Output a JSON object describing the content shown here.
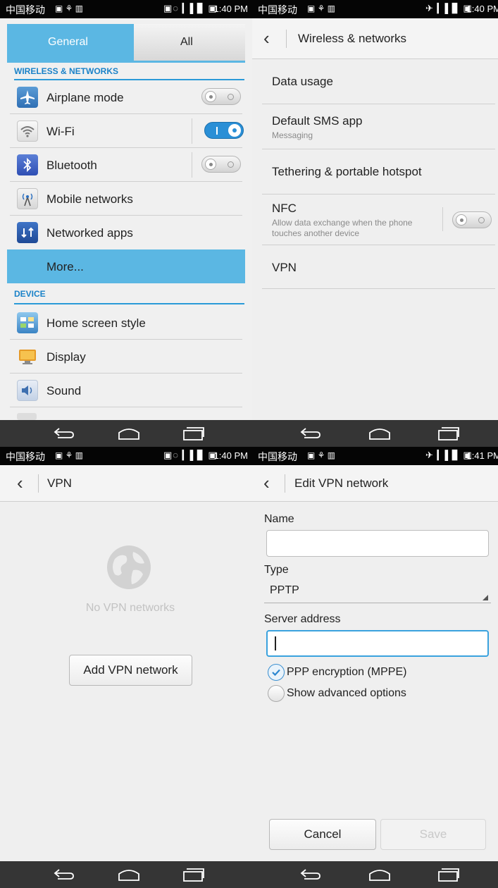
{
  "status": {
    "carrier": "中国移动",
    "times": [
      "1:40 PM",
      "1:40 PM",
      "1:40 PM",
      "1:41 PM"
    ]
  },
  "panel1": {
    "tab_general": "General",
    "tab_all": "All",
    "section_wireless": "WIRELESS & NETWORKS",
    "section_device": "DEVICE",
    "items": {
      "airplane": "Airplane mode",
      "wifi": "Wi-Fi",
      "bluetooth": "Bluetooth",
      "mobile": "Mobile networks",
      "networked_apps": "Networked apps",
      "more": "More...",
      "home_screen": "Home screen style",
      "display": "Display",
      "sound": "Sound"
    },
    "toggles": {
      "airplane": "off",
      "wifi": "on",
      "bluetooth": "off"
    },
    "accent_color": "#5bb7e3"
  },
  "panel2": {
    "title": "Wireless & networks",
    "data_usage": "Data usage",
    "default_sms": "Default SMS app",
    "default_sms_sub": "Messaging",
    "tethering": "Tethering & portable hotspot",
    "nfc": "NFC",
    "nfc_sub_1": "Allow data exchange when the phone",
    "nfc_sub_2": "touches another device",
    "vpn": "VPN"
  },
  "panel3": {
    "title": "VPN",
    "empty_text": "No VPN networks",
    "add_button": "Add VPN network"
  },
  "panel4": {
    "title": "Edit VPN network",
    "name_label": "Name",
    "name_value": "",
    "type_label": "Type",
    "type_value": "PPTP",
    "server_label": "Server address",
    "server_value": "",
    "ppp_label": "PPP encryption (MPPE)",
    "ppp_checked": true,
    "advanced_label": "Show advanced options",
    "advanced_checked": false,
    "cancel": "Cancel",
    "save": "Save"
  }
}
